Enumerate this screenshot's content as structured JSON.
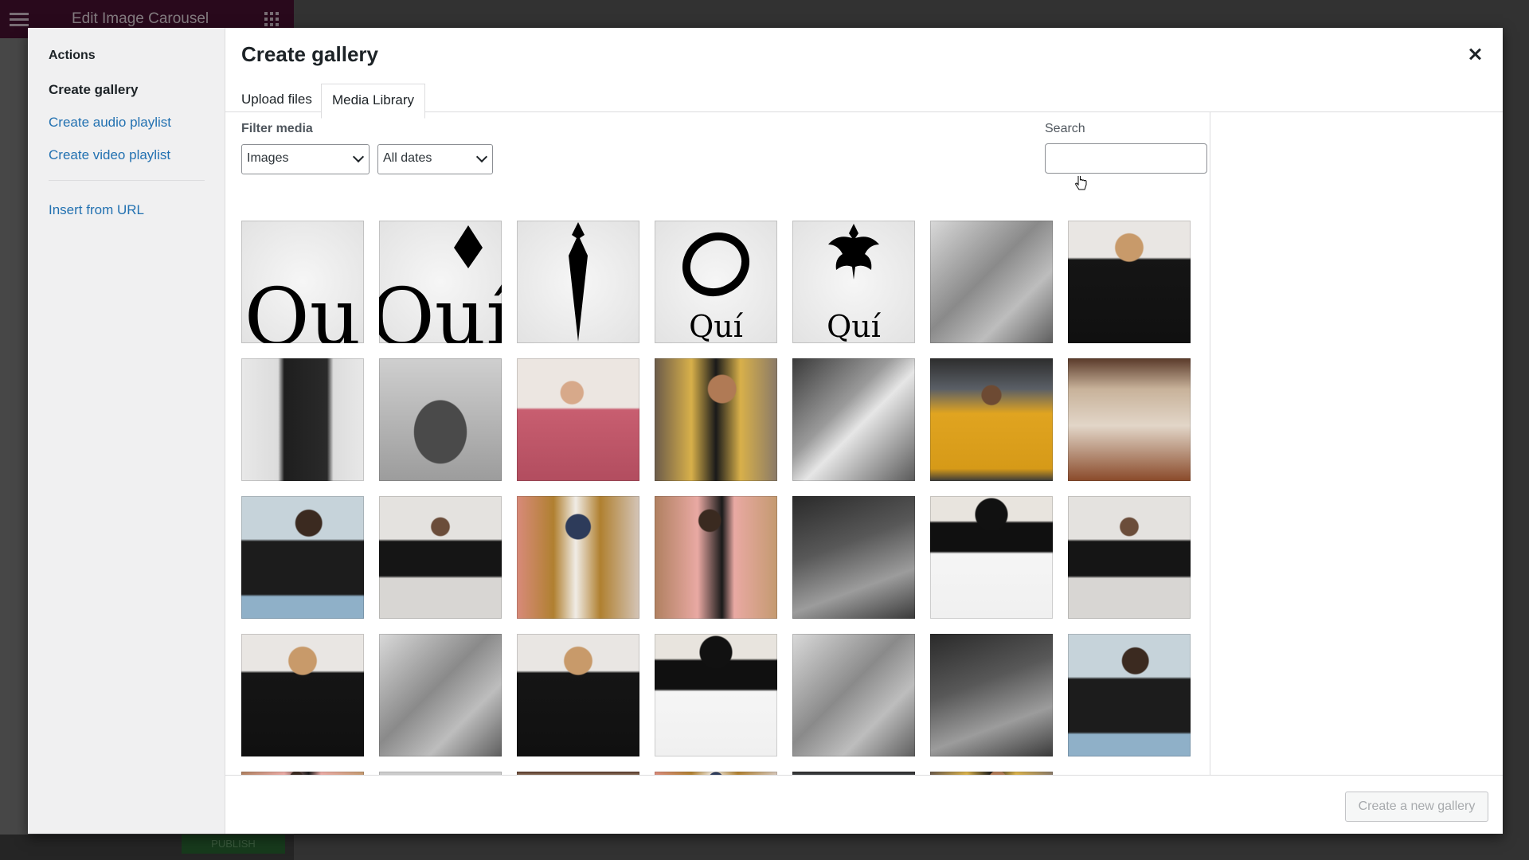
{
  "background": {
    "editor_title": "Edit Image Carousel",
    "publish_label": "PUBLISH"
  },
  "sidebar": {
    "heading": "Actions",
    "items": [
      {
        "label": "Create gallery",
        "active": true
      },
      {
        "label": "Create audio playlist",
        "active": false
      },
      {
        "label": "Create video playlist",
        "active": false
      }
    ],
    "insert_from_url": "Insert from URL"
  },
  "modal": {
    "title": "Create gallery",
    "close_icon": "close-icon",
    "tabs": [
      {
        "label": "Upload files",
        "active": false
      },
      {
        "label": "Media Library",
        "active": true
      }
    ]
  },
  "filter": {
    "label": "Filter media",
    "type_value": "Images",
    "date_value": "All dates"
  },
  "search": {
    "label": "Search",
    "value": ""
  },
  "media": {
    "rows": [
      [
        "logo-qu",
        "logo-qui-diamond",
        "logo-dagger",
        "logo-ring-qui",
        "logo-fleur-qui",
        "bw-hooded-man",
        "curly-woman-black"
      ],
      [
        "bw-legs-stool",
        "bw-crouching",
        "woman-pink-coat",
        "man-yellow-blazer",
        "bw-denim-jacket",
        "man-yellow-hoodie",
        "beige-layered"
      ],
      [
        "man-headphones",
        "man-tshirt-poles",
        "woman-mustard-coat",
        "woman-pink-coat-brick",
        "bw-hands-closeup",
        "afro-woman-white-pants",
        "man-tshirt-poles"
      ],
      [
        "curly-woman-black",
        "bw-hooded-man",
        "curly-woman-black",
        "afro-woman-white-pants",
        "bw-hooded-man",
        "bw-hands-closeup",
        "man-headphones"
      ],
      [
        "woman-pink-coat-brick",
        "bw-crouching",
        "beige-layered",
        "woman-mustard-coat",
        "man-yellow-hoodie",
        "man-yellow-blazer"
      ]
    ],
    "logo_texts": {
      "logo-qu": "Qu",
      "logo-qui-diamond": "Quí",
      "logo-ring-qui": "Quí",
      "logo-fleur-qui": "Quí"
    }
  },
  "footer": {
    "create_button": "Create a new gallery"
  }
}
